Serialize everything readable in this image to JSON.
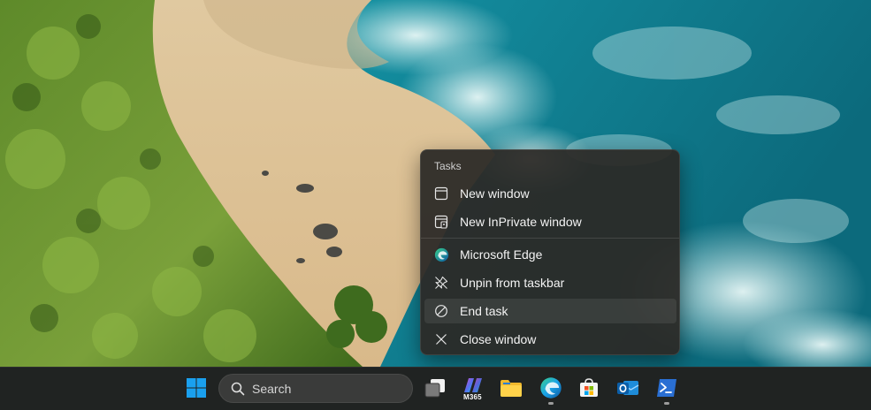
{
  "jumplist": {
    "heading": "Tasks",
    "tasks": [
      {
        "label": "New window",
        "icon": "window-icon"
      },
      {
        "label": "New InPrivate window",
        "icon": "inprivate-window-icon"
      }
    ],
    "actions": [
      {
        "label": "Microsoft Edge",
        "icon": "edge-icon"
      },
      {
        "label": "Unpin from taskbar",
        "icon": "unpin-icon"
      },
      {
        "label": "End task",
        "icon": "end-task-icon",
        "highlighted": true
      },
      {
        "label": "Close window",
        "icon": "close-icon"
      }
    ]
  },
  "taskbar": {
    "search_placeholder": "Search",
    "m365_label": "M365",
    "apps": [
      {
        "name": "start",
        "icon": "windows-logo-icon",
        "running": false
      },
      {
        "name": "task-view",
        "icon": "task-view-icon",
        "running": false
      },
      {
        "name": "microsoft-365-copilot",
        "icon": "m365-icon",
        "running": false
      },
      {
        "name": "file-explorer",
        "icon": "folder-icon",
        "running": false
      },
      {
        "name": "microsoft-edge",
        "icon": "edge-icon",
        "running": true
      },
      {
        "name": "microsoft-store",
        "icon": "store-icon",
        "running": false
      },
      {
        "name": "outlook",
        "icon": "outlook-icon",
        "running": false
      },
      {
        "name": "terminal",
        "icon": "terminal-icon",
        "running": true
      }
    ]
  },
  "colors": {
    "menu_bg": "#2c2926",
    "taskbar_bg": "#202322",
    "accent_blue": "#0f8de6"
  }
}
